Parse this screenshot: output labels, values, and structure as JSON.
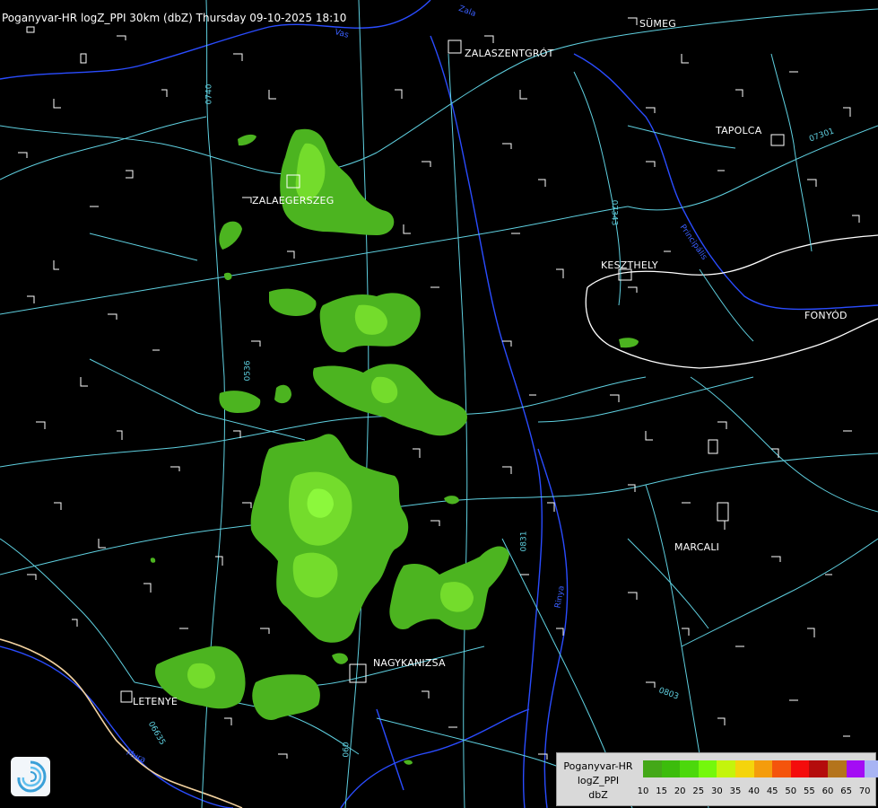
{
  "title": "Poganyvar-HR logZ_PPI 30km (dbZ) Thursday 09-10-2025 18:10",
  "cities": [
    {
      "key": "sumeg",
      "name": "SÜMEG"
    },
    {
      "key": "zalaszentgrot",
      "name": "ZALASZENTGRÓT"
    },
    {
      "key": "tapolca",
      "name": "TAPOLCA"
    },
    {
      "key": "zalaegerszeg",
      "name": "ZALAEGERSZEG"
    },
    {
      "key": "keszthely",
      "name": "KESZTHELY"
    },
    {
      "key": "fonyod",
      "name": "FONYÓD"
    },
    {
      "key": "marcali",
      "name": "MARCALI"
    },
    {
      "key": "nagykanizsa",
      "name": "NAGYKANIZSA"
    },
    {
      "key": "letenye",
      "name": "LETENYE"
    }
  ],
  "road_labels": [
    "0740",
    "07343",
    "0536",
    "0831",
    "0803",
    "06635",
    "060",
    "07301"
  ],
  "river_labels": [
    "Zala",
    "Vas",
    "Principális",
    "Rinya",
    "Mura"
  ],
  "legend": {
    "title_lines": [
      "Poganyvar-HR",
      "logZ_PPI",
      "dbZ"
    ],
    "ticks": [
      "10",
      "15",
      "20",
      "25",
      "30",
      "35",
      "40",
      "45",
      "50",
      "55",
      "60",
      "65",
      "70"
    ],
    "colors": [
      "#44a818",
      "#3cbc0c",
      "#4cd80c",
      "#74f80c",
      "#c4f40c",
      "#f4d40c",
      "#f49c0c",
      "#f4540c",
      "#f40c0c",
      "#b40c0c",
      "#b4741c",
      "#a40cf4",
      "#a8b4f4"
    ]
  },
  "colors": {
    "road": "#5fd0e0",
    "river": "#2a4cff",
    "border": "#f2d2a0",
    "echo_low": "#4cb420",
    "echo_mid": "#74dc2c",
    "echo_high": "#8cf83c"
  }
}
